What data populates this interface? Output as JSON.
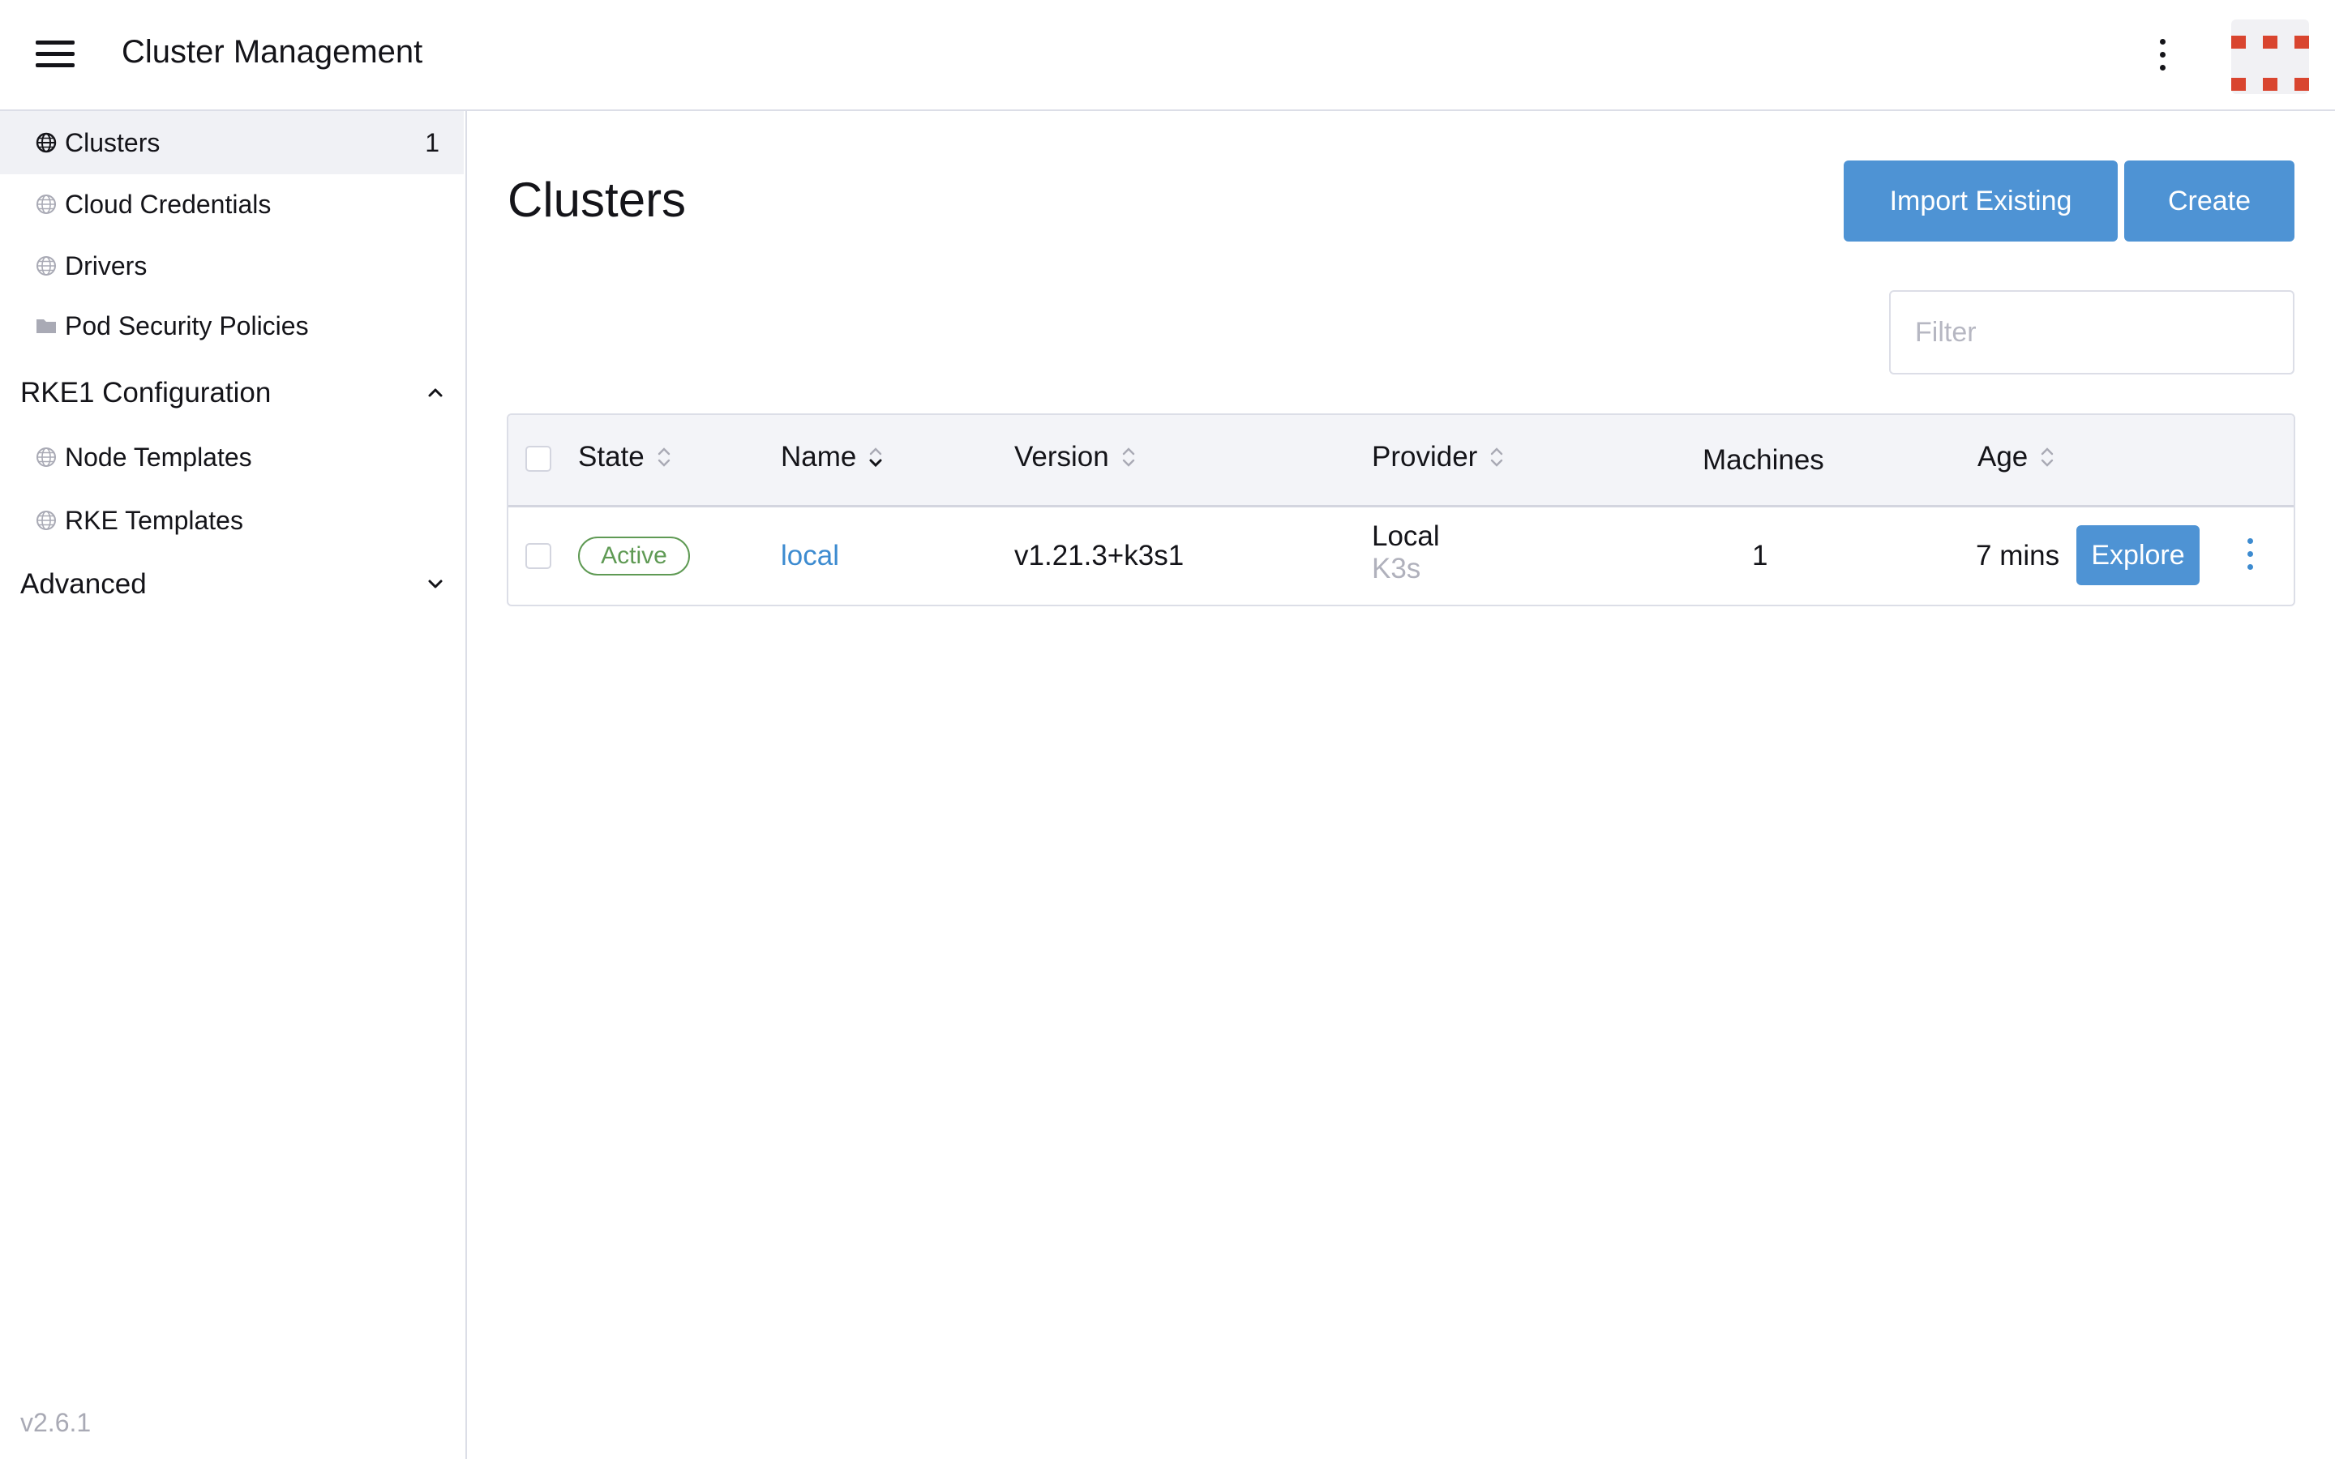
{
  "header": {
    "title": "Cluster Management",
    "menu_icon": "hamburger-icon",
    "more_icon": "kebab-vertical-icon",
    "logo_icon": "brand-logo-icon",
    "brand_color": "#d9452f"
  },
  "sidebar": {
    "items": [
      {
        "label": "Clusters",
        "count": "1",
        "icon": "globe-icon",
        "active": true
      },
      {
        "label": "Cloud Credentials",
        "icon": "globe-icon"
      },
      {
        "label": "Drivers",
        "icon": "globe-icon"
      },
      {
        "label": "Pod Security Policies",
        "icon": "folder-icon"
      }
    ],
    "groups": [
      {
        "label": "RKE1 Configuration",
        "expanded": true,
        "items": [
          {
            "label": "Node Templates",
            "icon": "globe-icon"
          },
          {
            "label": "RKE Templates",
            "icon": "globe-icon"
          }
        ]
      },
      {
        "label": "Advanced",
        "expanded": false,
        "items": []
      }
    ],
    "version": "v2.6.1"
  },
  "main": {
    "title": "Clusters",
    "buttons": {
      "import": "Import Existing",
      "create": "Create"
    },
    "filter_placeholder": "Filter",
    "accent_color": "#4e93d4"
  },
  "table": {
    "columns": [
      "State",
      "Name",
      "Version",
      "Provider",
      "Machines",
      "Age"
    ],
    "rows": [
      {
        "state": "Active",
        "name": "local",
        "version": "v1.21.3+k3s1",
        "provider": "Local",
        "provider_sub": "K3s",
        "machines": "1",
        "age": "7 mins",
        "action": "Explore"
      }
    ],
    "status_color": "#5f9a54"
  }
}
